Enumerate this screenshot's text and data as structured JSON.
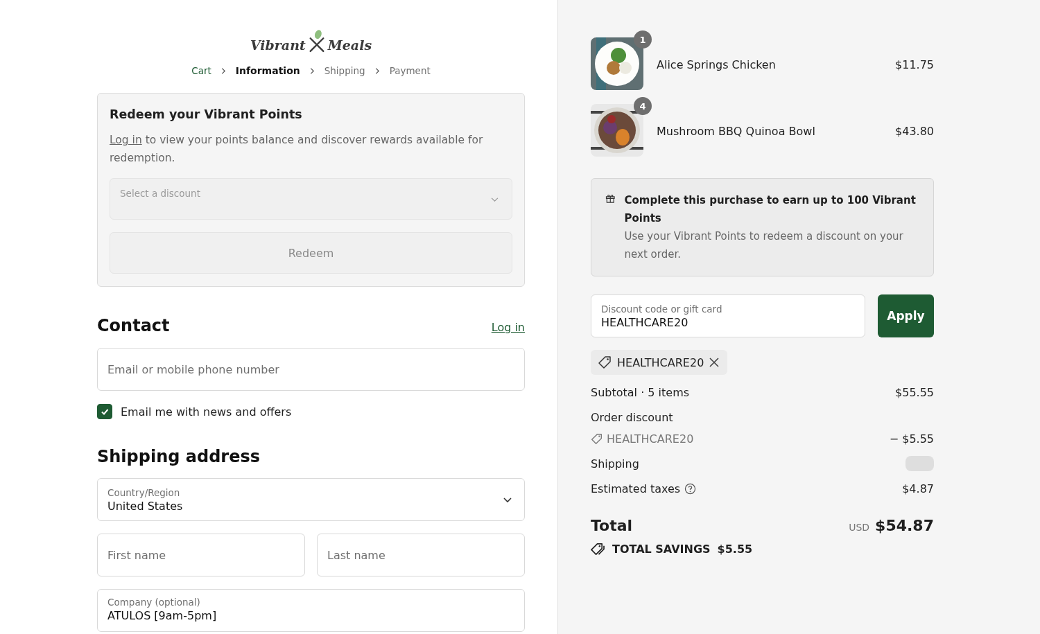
{
  "logo": {
    "left": "Vibrant",
    "right": "Meals"
  },
  "breadcrumbs": [
    {
      "label": "Cart",
      "selected": false,
      "visited": true
    },
    {
      "label": "Information",
      "selected": true,
      "visited": false
    },
    {
      "label": "Shipping",
      "selected": false,
      "visited": false
    },
    {
      "label": "Payment",
      "selected": false,
      "visited": false
    }
  ],
  "points_card": {
    "title": "Redeem your Vibrant Points",
    "link": "Log in",
    "text": " to view your points balance and discover rewards available for redemption.",
    "select": {
      "placeholder": "Select a discount"
    },
    "button": {
      "label": "Redeem",
      "disabled": true
    }
  },
  "contact": {
    "heading": "Contact",
    "login_link": "Log in",
    "email": {
      "placeholder": "Email or mobile phone number"
    },
    "newsletter": {
      "label": "Email me with news and offers",
      "checked": true
    }
  },
  "shipping_address": {
    "heading": "Shipping address",
    "country": {
      "label": "Country/Region",
      "value": "United States"
    },
    "first_name": {
      "placeholder": "First name"
    },
    "last_name": {
      "placeholder": "Last name"
    },
    "company": {
      "label": "Company (optional)",
      "value": "ATULOS [9am-5pm]"
    }
  },
  "order_items": [
    {
      "name": "Alice Springs Chicken",
      "quantity": "1",
      "price": "$11.75"
    },
    {
      "name": "Mushroom BBQ Quinoa Bowl",
      "quantity": "4",
      "price": "$43.80"
    }
  ],
  "rewards_banner": {
    "title": "Complete this purchase to earn up to 100 Vibrant Points",
    "text": "Use your Vibrant Points to redeem a discount on your next order."
  },
  "discount": {
    "label": "Discount code or gift card",
    "value": "HEALTHCARE20",
    "button": "Apply",
    "applied_tag": "HEALTHCARE20"
  },
  "summary": {
    "subtotal_label": "Subtotal · 5 items",
    "subtotal": "$55.55",
    "discount_label": "Order discount",
    "discount_code": "HEALTHCARE20",
    "discount_amount": "− $5.55",
    "shipping_label": "Shipping",
    "shipping_loading": true,
    "taxes_label": "Estimated taxes",
    "taxes": "$4.87",
    "total_label": "Total",
    "currency": "USD",
    "total": "$54.87",
    "savings_label": "TOTAL SAVINGS",
    "savings": "$5.55"
  }
}
